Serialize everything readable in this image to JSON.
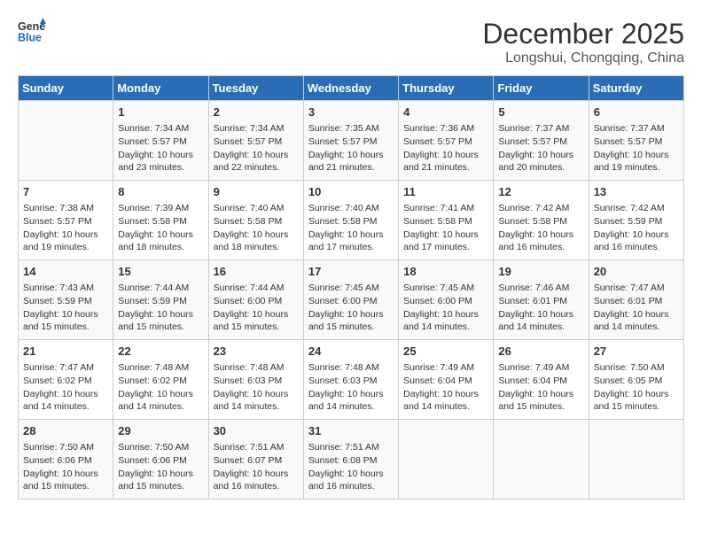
{
  "header": {
    "logo_line1": "General",
    "logo_line2": "Blue",
    "month": "December 2025",
    "location": "Longshui, Chongqing, China"
  },
  "weekdays": [
    "Sunday",
    "Monday",
    "Tuesday",
    "Wednesday",
    "Thursday",
    "Friday",
    "Saturday"
  ],
  "weeks": [
    [
      {
        "day": "",
        "info": ""
      },
      {
        "day": "1",
        "info": "Sunrise: 7:34 AM\nSunset: 5:57 PM\nDaylight: 10 hours\nand 23 minutes."
      },
      {
        "day": "2",
        "info": "Sunrise: 7:34 AM\nSunset: 5:57 PM\nDaylight: 10 hours\nand 22 minutes."
      },
      {
        "day": "3",
        "info": "Sunrise: 7:35 AM\nSunset: 5:57 PM\nDaylight: 10 hours\nand 21 minutes."
      },
      {
        "day": "4",
        "info": "Sunrise: 7:36 AM\nSunset: 5:57 PM\nDaylight: 10 hours\nand 21 minutes."
      },
      {
        "day": "5",
        "info": "Sunrise: 7:37 AM\nSunset: 5:57 PM\nDaylight: 10 hours\nand 20 minutes."
      },
      {
        "day": "6",
        "info": "Sunrise: 7:37 AM\nSunset: 5:57 PM\nDaylight: 10 hours\nand 19 minutes."
      }
    ],
    [
      {
        "day": "7",
        "info": "Sunrise: 7:38 AM\nSunset: 5:57 PM\nDaylight: 10 hours\nand 19 minutes."
      },
      {
        "day": "8",
        "info": "Sunrise: 7:39 AM\nSunset: 5:58 PM\nDaylight: 10 hours\nand 18 minutes."
      },
      {
        "day": "9",
        "info": "Sunrise: 7:40 AM\nSunset: 5:58 PM\nDaylight: 10 hours\nand 18 minutes."
      },
      {
        "day": "10",
        "info": "Sunrise: 7:40 AM\nSunset: 5:58 PM\nDaylight: 10 hours\nand 17 minutes."
      },
      {
        "day": "11",
        "info": "Sunrise: 7:41 AM\nSunset: 5:58 PM\nDaylight: 10 hours\nand 17 minutes."
      },
      {
        "day": "12",
        "info": "Sunrise: 7:42 AM\nSunset: 5:58 PM\nDaylight: 10 hours\nand 16 minutes."
      },
      {
        "day": "13",
        "info": "Sunrise: 7:42 AM\nSunset: 5:59 PM\nDaylight: 10 hours\nand 16 minutes."
      }
    ],
    [
      {
        "day": "14",
        "info": "Sunrise: 7:43 AM\nSunset: 5:59 PM\nDaylight: 10 hours\nand 15 minutes."
      },
      {
        "day": "15",
        "info": "Sunrise: 7:44 AM\nSunset: 5:59 PM\nDaylight: 10 hours\nand 15 minutes."
      },
      {
        "day": "16",
        "info": "Sunrise: 7:44 AM\nSunset: 6:00 PM\nDaylight: 10 hours\nand 15 minutes."
      },
      {
        "day": "17",
        "info": "Sunrise: 7:45 AM\nSunset: 6:00 PM\nDaylight: 10 hours\nand 15 minutes."
      },
      {
        "day": "18",
        "info": "Sunrise: 7:45 AM\nSunset: 6:00 PM\nDaylight: 10 hours\nand 14 minutes."
      },
      {
        "day": "19",
        "info": "Sunrise: 7:46 AM\nSunset: 6:01 PM\nDaylight: 10 hours\nand 14 minutes."
      },
      {
        "day": "20",
        "info": "Sunrise: 7:47 AM\nSunset: 6:01 PM\nDaylight: 10 hours\nand 14 minutes."
      }
    ],
    [
      {
        "day": "21",
        "info": "Sunrise: 7:47 AM\nSunset: 6:02 PM\nDaylight: 10 hours\nand 14 minutes."
      },
      {
        "day": "22",
        "info": "Sunrise: 7:48 AM\nSunset: 6:02 PM\nDaylight: 10 hours\nand 14 minutes."
      },
      {
        "day": "23",
        "info": "Sunrise: 7:48 AM\nSunset: 6:03 PM\nDaylight: 10 hours\nand 14 minutes."
      },
      {
        "day": "24",
        "info": "Sunrise: 7:48 AM\nSunset: 6:03 PM\nDaylight: 10 hours\nand 14 minutes."
      },
      {
        "day": "25",
        "info": "Sunrise: 7:49 AM\nSunset: 6:04 PM\nDaylight: 10 hours\nand 14 minutes."
      },
      {
        "day": "26",
        "info": "Sunrise: 7:49 AM\nSunset: 6:04 PM\nDaylight: 10 hours\nand 15 minutes."
      },
      {
        "day": "27",
        "info": "Sunrise: 7:50 AM\nSunset: 6:05 PM\nDaylight: 10 hours\nand 15 minutes."
      }
    ],
    [
      {
        "day": "28",
        "info": "Sunrise: 7:50 AM\nSunset: 6:06 PM\nDaylight: 10 hours\nand 15 minutes."
      },
      {
        "day": "29",
        "info": "Sunrise: 7:50 AM\nSunset: 6:06 PM\nDaylight: 10 hours\nand 15 minutes."
      },
      {
        "day": "30",
        "info": "Sunrise: 7:51 AM\nSunset: 6:07 PM\nDaylight: 10 hours\nand 16 minutes."
      },
      {
        "day": "31",
        "info": "Sunrise: 7:51 AM\nSunset: 6:08 PM\nDaylight: 10 hours\nand 16 minutes."
      },
      {
        "day": "",
        "info": ""
      },
      {
        "day": "",
        "info": ""
      },
      {
        "day": "",
        "info": ""
      }
    ]
  ]
}
